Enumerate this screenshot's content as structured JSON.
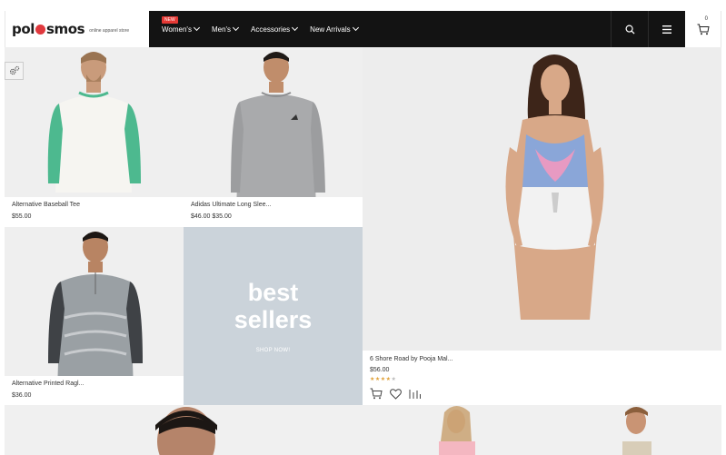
{
  "brand": {
    "logo_pre": "pol",
    "logo_post": "smos",
    "tagline": "online apparel store"
  },
  "nav": {
    "items": [
      {
        "label": "Women's",
        "badge": "NEW"
      },
      {
        "label": "Men's"
      },
      {
        "label": "Accessories"
      },
      {
        "label": "New Arrivals"
      }
    ],
    "search_icon": "search-icon",
    "menu_icon": "hamburger-icon",
    "cart_count": "0"
  },
  "products": [
    {
      "name": "Alternative Baseball Tee",
      "price": "$55.00"
    },
    {
      "name": "Adidas Ultimate Long Slee...",
      "price": "$46.00 $35.00"
    },
    {
      "name": "Alternative Printed Ragl...",
      "price": "$36.00"
    },
    {
      "name": "6 Shore Road by Pooja Mal...",
      "price": "$56.00",
      "rating": 4
    }
  ],
  "promo": {
    "title_line1": "best",
    "title_line2": "sellers",
    "link": "SHOP NOW!"
  },
  "colors": {
    "accent": "#e53935",
    "header_bg": "#131313",
    "promo_bg": "#cbd3da"
  }
}
